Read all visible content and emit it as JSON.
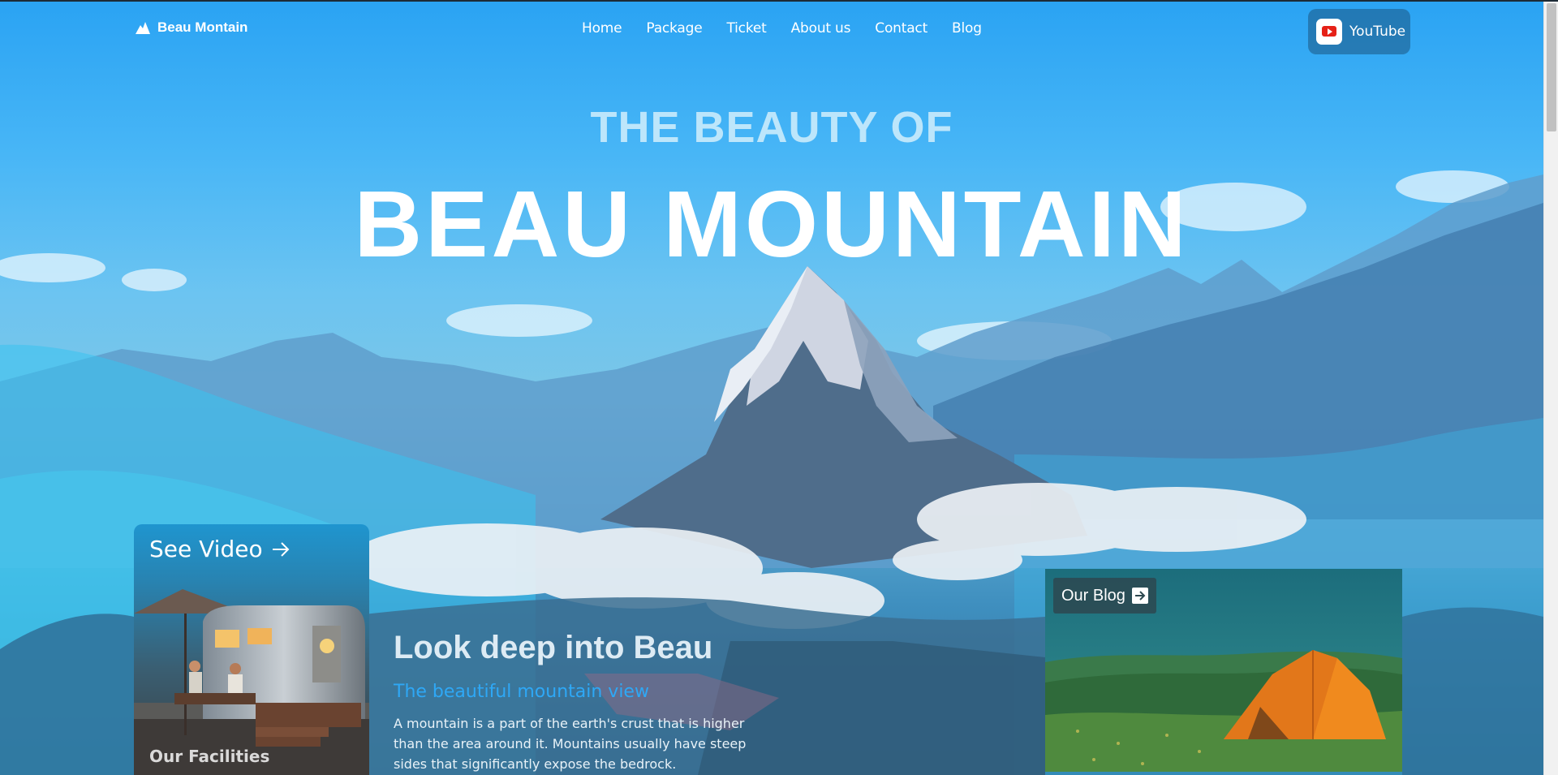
{
  "brand": {
    "name": "Beau Montain"
  },
  "nav": {
    "items": [
      "Home",
      "Package",
      "Ticket",
      "About us",
      "Contact",
      "Blog"
    ]
  },
  "youtube": {
    "label": "YouTube"
  },
  "hero": {
    "subtitle": "THE BEAUTY OF",
    "title": "BEAU MOUNTAIN"
  },
  "video_card": {
    "title": "See Video",
    "caption": "Our Facilities"
  },
  "content": {
    "heading": "Look deep into Beau",
    "subheading": "The beautiful mountain view",
    "paragraph": "A mountain is a part of the earth's crust that is higher than the area around it. Mountains usually have steep sides that significantly expose the bedrock."
  },
  "blog_card": {
    "label": "Our Blog"
  },
  "colors": {
    "sky": "#2aa3f3",
    "accent_blue": "#2ea8f6",
    "tent": "#f08a1e",
    "youtube_red": "#e62117"
  }
}
